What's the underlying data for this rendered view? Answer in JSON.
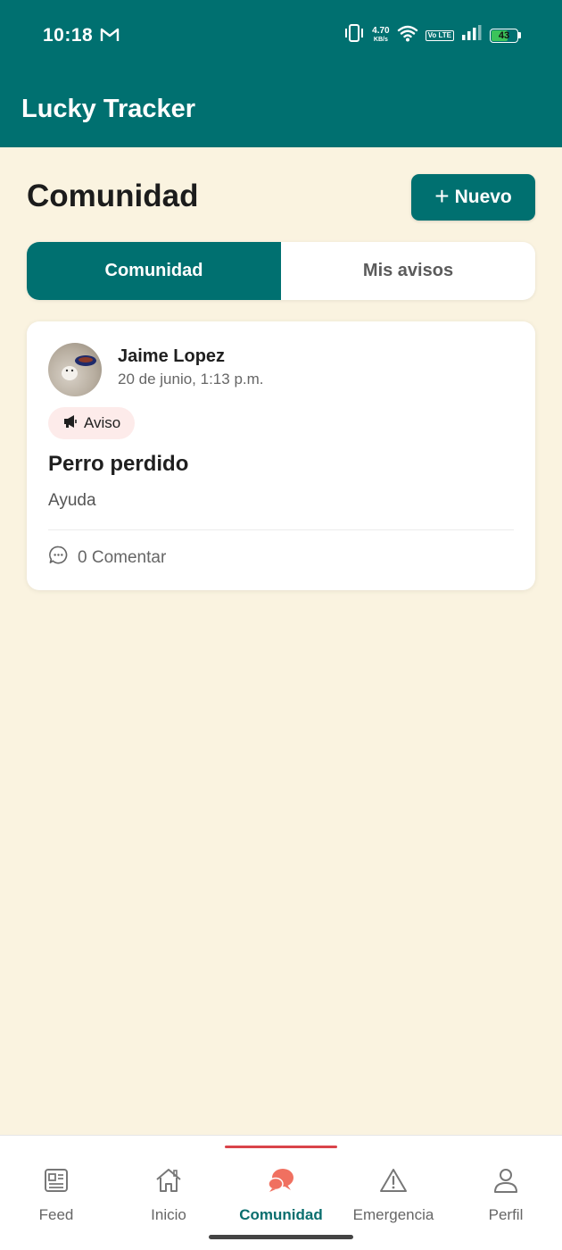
{
  "status_bar": {
    "time": "10:18",
    "net_speed_value": "4.70",
    "net_speed_unit": "KB/s",
    "volte_label": "Vo LTE",
    "battery_level": "43"
  },
  "app_bar": {
    "title": "Lucky Tracker"
  },
  "header": {
    "title": "Comunidad",
    "new_button_label": "Nuevo"
  },
  "tabs": [
    {
      "label": "Comunidad",
      "active": true
    },
    {
      "label": "Mis avisos",
      "active": false
    }
  ],
  "posts": [
    {
      "author": "Jaime Lopez",
      "date": "20 de junio, 1:13 p.m.",
      "badge": "Aviso",
      "title": "Perro perdido",
      "body": "Ayuda",
      "comment_label": "0 Comentar"
    }
  ],
  "bottom_nav": [
    {
      "label": "Feed",
      "icon": "newspaper-icon",
      "active": false
    },
    {
      "label": "Inicio",
      "icon": "home-icon",
      "active": false
    },
    {
      "label": "Comunidad",
      "icon": "chat-bubbles-icon",
      "active": true
    },
    {
      "label": "Emergencia",
      "icon": "warning-icon",
      "active": false
    },
    {
      "label": "Perfil",
      "icon": "user-icon",
      "active": false
    }
  ],
  "colors": {
    "primary": "#007070",
    "background": "#FAF3E0",
    "accent": "#F07060",
    "badge_bg": "#FDEBEA",
    "nav_indicator": "#D9434A"
  }
}
